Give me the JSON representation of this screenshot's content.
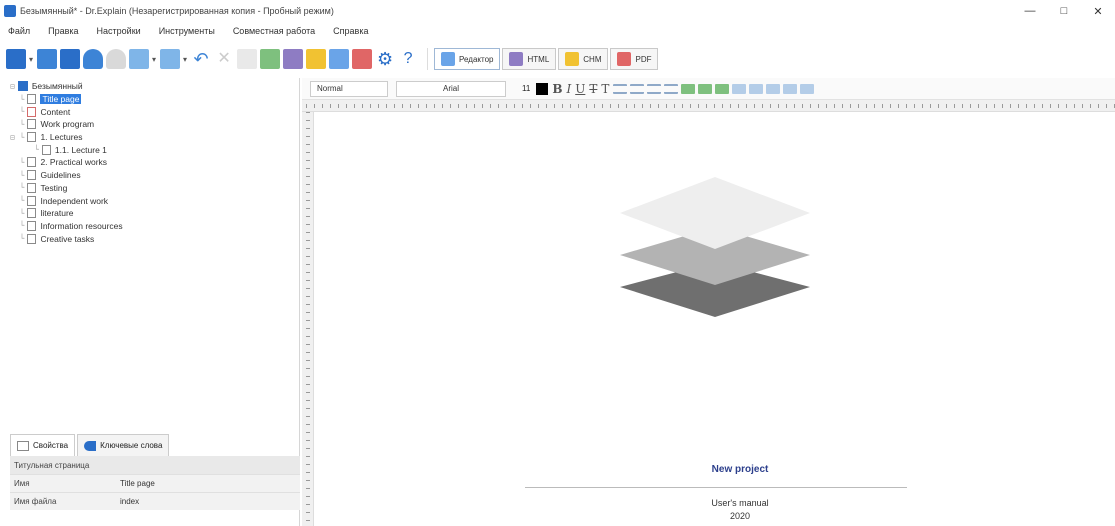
{
  "window": {
    "title": "Безымянный* - Dr.Explain (Незарегистрированная копия - Пробный режим)",
    "controls": {
      "minimize": "—",
      "maximize": "□",
      "close": "✕"
    }
  },
  "menu": [
    "Файл",
    "Правка",
    "Настройки",
    "Инструменты",
    "Совместная работа",
    "Справка"
  ],
  "mode_tabs": [
    {
      "label": "Редактор",
      "active": true,
      "color": "#6aa4e8"
    },
    {
      "label": "HTML",
      "active": false,
      "color": "#8e7cc3"
    },
    {
      "label": "CHM",
      "active": false,
      "color": "#f1c232"
    },
    {
      "label": "PDF",
      "active": false,
      "color": "#e06666"
    }
  ],
  "tree": {
    "root": "Безымянный",
    "items": [
      {
        "label": "Title page",
        "selected": true
      },
      {
        "label": "Content"
      },
      {
        "label": "Work program"
      },
      {
        "label": "1. Lectures"
      },
      {
        "label": "1.1. Lecture 1"
      },
      {
        "label": "2. Practical works"
      },
      {
        "label": "Guidelines"
      },
      {
        "label": "Testing"
      },
      {
        "label": "Independent work"
      },
      {
        "label": "literature"
      },
      {
        "label": "Information resources"
      },
      {
        "label": "Creative tasks"
      }
    ]
  },
  "props": {
    "tabs": [
      "Свойства",
      "Ключевые слова"
    ],
    "section": "Титульная страница",
    "rows": [
      {
        "key": "Имя",
        "value": "Title page"
      },
      {
        "key": "Имя файла",
        "value": "index"
      }
    ]
  },
  "format": {
    "style": "Normal",
    "font": "Arial",
    "size": "11"
  },
  "document": {
    "title": "New project",
    "subtitle": "User's manual",
    "year": "2020"
  }
}
